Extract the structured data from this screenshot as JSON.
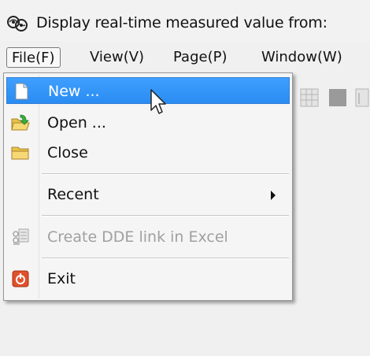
{
  "window": {
    "title": "Display real-time measured value from:"
  },
  "menubar": {
    "items": [
      {
        "label": "File(F)",
        "active": true
      },
      {
        "label": "View(V)",
        "active": false
      },
      {
        "label": "Page(P)",
        "active": false
      },
      {
        "label": "Window(W)",
        "active": false
      }
    ]
  },
  "file_menu": {
    "items": [
      {
        "label": "New ...",
        "icon": "new-file-icon",
        "highlighted": true,
        "enabled": true
      },
      {
        "label": "Open ...",
        "icon": "open-folder-icon",
        "highlighted": false,
        "enabled": true
      },
      {
        "label": "Close",
        "icon": "folder-icon",
        "highlighted": false,
        "enabled": true
      },
      {
        "label": "Recent",
        "icon": null,
        "has_submenu": true,
        "enabled": true
      },
      {
        "label": "Create DDE link in Excel",
        "icon": "dde-link-icon",
        "enabled": false
      },
      {
        "label": "Exit",
        "icon": "exit-icon",
        "enabled": true
      }
    ]
  },
  "colors": {
    "highlight": "#3399ff",
    "menu_background": "#f5f5f5",
    "disabled_text": "#a0a0a0",
    "exit_icon": "#e0502a"
  }
}
